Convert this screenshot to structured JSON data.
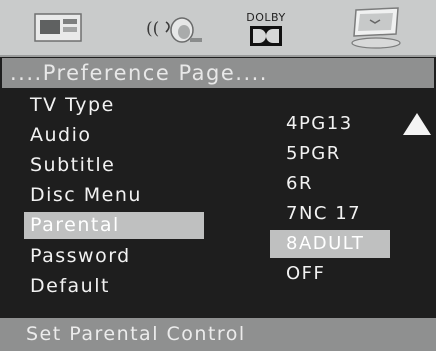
{
  "header": {
    "title": "....Preference Page...."
  },
  "icons": {
    "general": "tv-monitor-icon",
    "audio": "speaker-sound-icon",
    "dolby": "dolby-icon",
    "dolby_label": "DOLBY",
    "preference": "preference-monitor-icon"
  },
  "menu": {
    "items": [
      {
        "label": "TV Type"
      },
      {
        "label": "Audio"
      },
      {
        "label": "Subtitle"
      },
      {
        "label": "Disc Menu"
      },
      {
        "label": "Parental",
        "selected": true
      },
      {
        "label": "Password"
      },
      {
        "label": "Default"
      }
    ]
  },
  "options": {
    "items": [
      {
        "label": "4PG13"
      },
      {
        "label": "5PGR"
      },
      {
        "label": "6R"
      },
      {
        "label": "7NC 17"
      },
      {
        "label": "8ADULT",
        "selected": true
      },
      {
        "label": "OFF"
      }
    ]
  },
  "footer": {
    "help": "Set Parental Control"
  },
  "colors": {
    "background": "#1e1e1e",
    "bar": "#8f9090",
    "highlight": "#bfc0c0",
    "icon_bar": "#c9cbcb"
  }
}
